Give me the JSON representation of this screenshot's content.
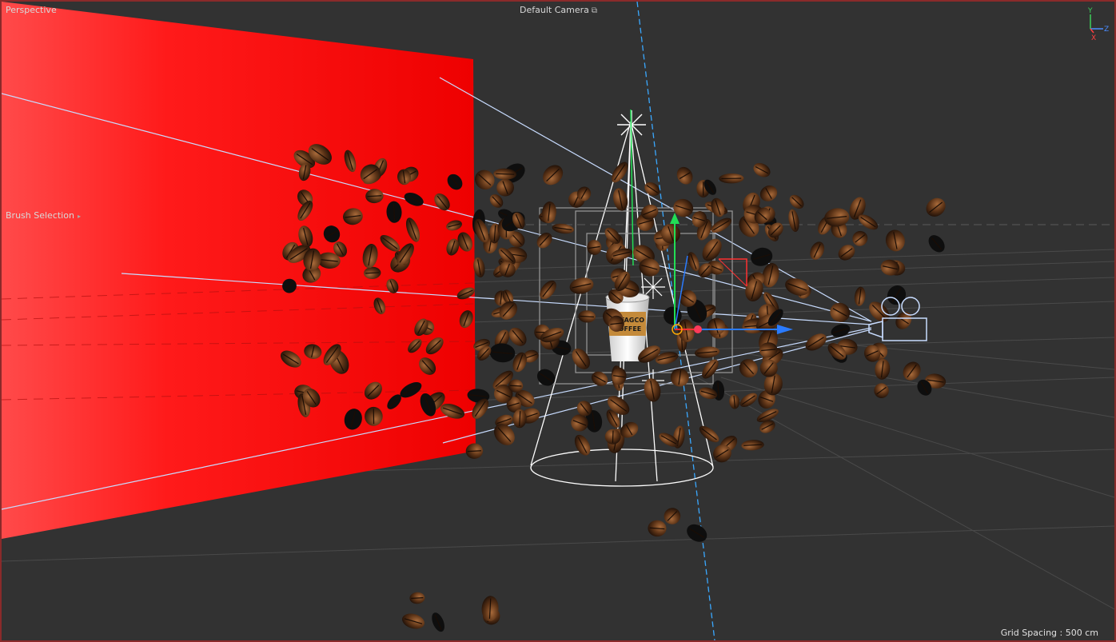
{
  "viewport": {
    "view_name": "Perspective",
    "camera_name": "Default Camera",
    "camera_icon": "camera-lock-icon",
    "brush_selection_label": "Brush Selection",
    "grid_spacing_text": "Grid Spacing : 500 cm",
    "border_color": "#8a2a2a",
    "background_color": "#323232"
  },
  "axis_gizmo": {
    "y_label": "Y",
    "z_label": "Z",
    "x_label": "X",
    "y_color": "#3cd05a",
    "z_color": "#4a8cff",
    "x_color": "#ff4040"
  },
  "scene": {
    "wall_color": "#ff1a1a",
    "cup_label": "DEFAGCO COFFEE",
    "bean_color": "#4a2a14",
    "wireframe_color": "#ffffff",
    "frustum_color": "#bfd8ff",
    "move_axis_colors": {
      "x": "#2a7bff",
      "y": "#22dd55",
      "z": "#ff3030"
    }
  }
}
